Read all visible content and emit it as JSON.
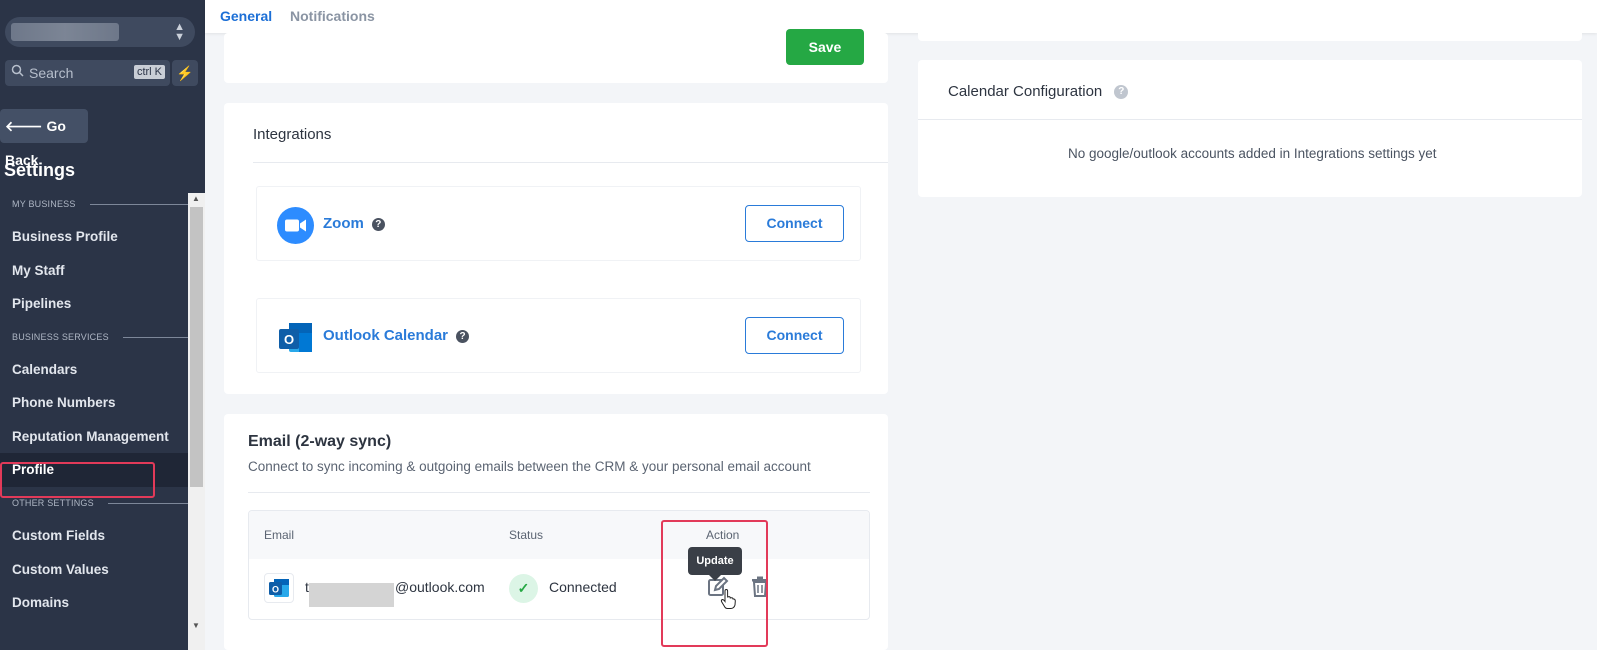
{
  "sidebar": {
    "search": {
      "label": "Search",
      "shortcut": "ctrl K"
    },
    "go_back": "Go Back",
    "title": "Settings",
    "sections": [
      {
        "label": "MY BUSINESS"
      },
      {
        "label": "BUSINESS SERVICES"
      },
      {
        "label": "OTHER SETTINGS"
      }
    ],
    "items": [
      {
        "label": "Business Profile"
      },
      {
        "label": "My Staff"
      },
      {
        "label": "Pipelines"
      },
      {
        "label": "Calendars"
      },
      {
        "label": "Phone Numbers"
      },
      {
        "label": "Reputation Management"
      },
      {
        "label": "Profile"
      },
      {
        "label": "Custom Fields"
      },
      {
        "label": "Custom Values"
      },
      {
        "label": "Domains"
      }
    ],
    "active_item": "Profile"
  },
  "tabs": [
    {
      "label": "General"
    },
    {
      "label": "Notifications"
    }
  ],
  "save_label": "Save",
  "integrations": {
    "heading": "Integrations",
    "items": [
      {
        "name": "Zoom",
        "button": "Connect"
      },
      {
        "name": "Outlook Calendar",
        "button": "Connect"
      }
    ]
  },
  "email_sync": {
    "title": "Email (2-way sync)",
    "description": "Connect to sync incoming & outgoing emails between the CRM & your personal email account",
    "columns": [
      "Email",
      "Status",
      "Action"
    ],
    "row": {
      "email_prefix": "t",
      "email_suffix": "@outlook.com",
      "status": "Connected"
    },
    "tooltip": "Update"
  },
  "calendar_config": {
    "title": "Calendar Configuration",
    "empty_message": "No google/outlook accounts added in Integrations settings yet"
  },
  "colors": {
    "sidebar_bg": "#2b3447",
    "accent_blue": "#2a7bd9",
    "save_green": "#25a844",
    "highlight_red": "#e23a59"
  }
}
